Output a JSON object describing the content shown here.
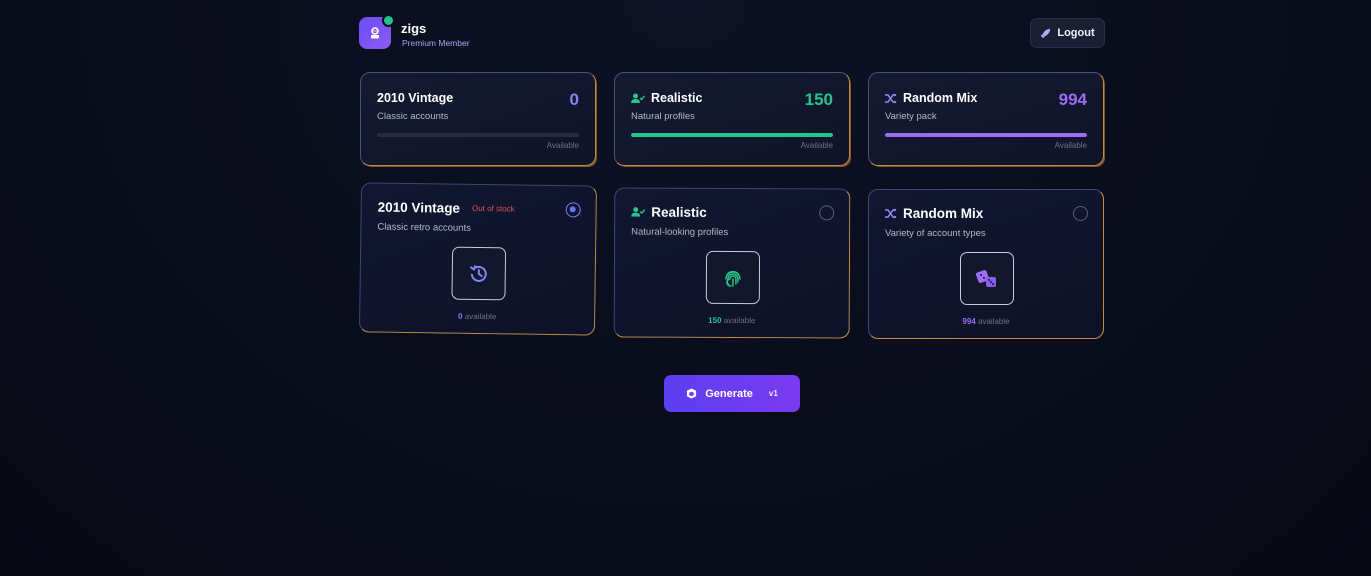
{
  "header": {
    "username": "zigs",
    "membership": "Premium Member",
    "logout_label": "Logout"
  },
  "stats": [
    {
      "title": "2010 Vintage",
      "subtitle": "Classic accounts",
      "count": "0",
      "available_label": "Available",
      "fill_fraction": 0.0,
      "color": "#7b86f8"
    },
    {
      "title": "Realistic",
      "subtitle": "Natural profiles",
      "count": "150",
      "available_label": "Available",
      "fill_fraction": 1.0,
      "color": "#22c58b"
    },
    {
      "title": "Random Mix",
      "subtitle": "Variety pack",
      "count": "994",
      "available_label": "Available",
      "fill_fraction": 1.0,
      "color": "#9b6cf6"
    }
  ],
  "options": [
    {
      "title": "2010 Vintage",
      "badge": "Out of stock",
      "subtitle": "Classic retro accounts",
      "count": "0",
      "available_label": "available",
      "selected": true,
      "icon": "history-icon",
      "color": "#7b86f8"
    },
    {
      "title": "Realistic",
      "badge": "",
      "subtitle": "Natural-looking profiles",
      "count": "150",
      "available_label": "available",
      "selected": false,
      "icon": "fingerprint-icon",
      "color": "#22c58b"
    },
    {
      "title": "Random Mix",
      "badge": "",
      "subtitle": "Variety of account types",
      "count": "994",
      "available_label": "available",
      "selected": false,
      "icon": "dice-icon",
      "color": "#9b6cf6"
    }
  ],
  "generate": {
    "label": "Generate",
    "version": "v1"
  }
}
